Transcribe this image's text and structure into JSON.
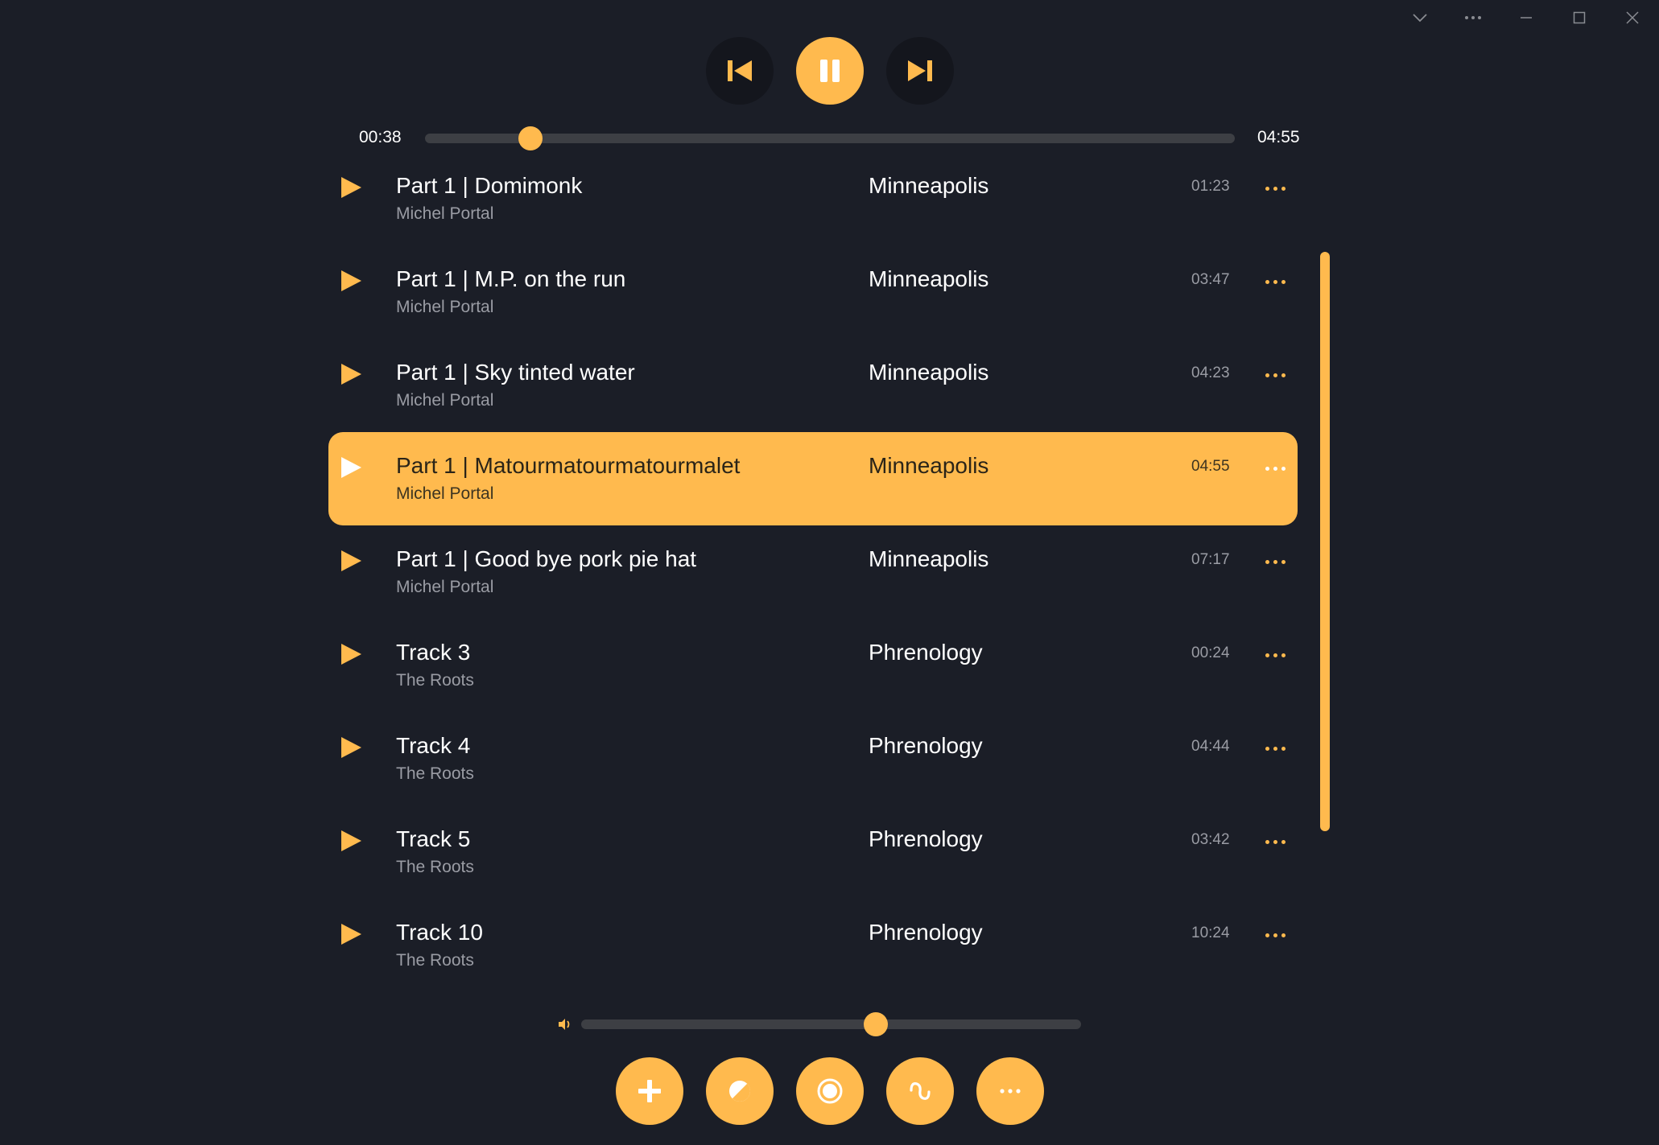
{
  "colors": {
    "accent": "#ffba4e",
    "background": "#1b1e27",
    "track": "#3d3f44",
    "muted_text": "#9a9ca4"
  },
  "titlebar": {
    "icons": [
      "chevron-down-icon",
      "more-icon",
      "minimize-icon",
      "maximize-icon",
      "close-icon"
    ]
  },
  "transport": {
    "icons": [
      "skip-previous-icon",
      "pause-icon",
      "skip-next-icon"
    ]
  },
  "playback": {
    "elapsed": "00:38",
    "total": "04:55",
    "progress": 0.13
  },
  "tracks": [
    {
      "title": "Part 1 | Domimonk",
      "artist": "Michel Portal",
      "album": "Minneapolis",
      "duration": "01:23",
      "active": false
    },
    {
      "title": "Part 1 | M.P. on the run",
      "artist": "Michel Portal",
      "album": "Minneapolis",
      "duration": "03:47",
      "active": false
    },
    {
      "title": "Part 1 | Sky tinted water",
      "artist": "Michel Portal",
      "album": "Minneapolis",
      "duration": "04:23",
      "active": false
    },
    {
      "title": "Part 1 | Matourmatourmatourmalet",
      "artist": "Michel Portal",
      "album": "Minneapolis",
      "duration": "04:55",
      "active": true
    },
    {
      "title": "Part 1 | Good bye pork pie hat",
      "artist": "Michel Portal",
      "album": "Minneapolis",
      "duration": "07:17",
      "active": false
    },
    {
      "title": "Track 3",
      "artist": "The Roots",
      "album": "Phrenology",
      "duration": "00:24",
      "active": false
    },
    {
      "title": "Track 4",
      "artist": "The Roots",
      "album": "Phrenology",
      "duration": "04:44",
      "active": false
    },
    {
      "title": "Track 5",
      "artist": "The Roots",
      "album": "Phrenology",
      "duration": "03:42",
      "active": false
    },
    {
      "title": "Track 10",
      "artist": "The Roots",
      "album": "Phrenology",
      "duration": "10:24",
      "active": false
    }
  ],
  "volume": {
    "level": 0.59,
    "icon": "volume-icon"
  },
  "actions": {
    "icons": [
      "add-icon",
      "theme-icon",
      "record-icon",
      "equalizer-icon",
      "more-icon"
    ]
  }
}
